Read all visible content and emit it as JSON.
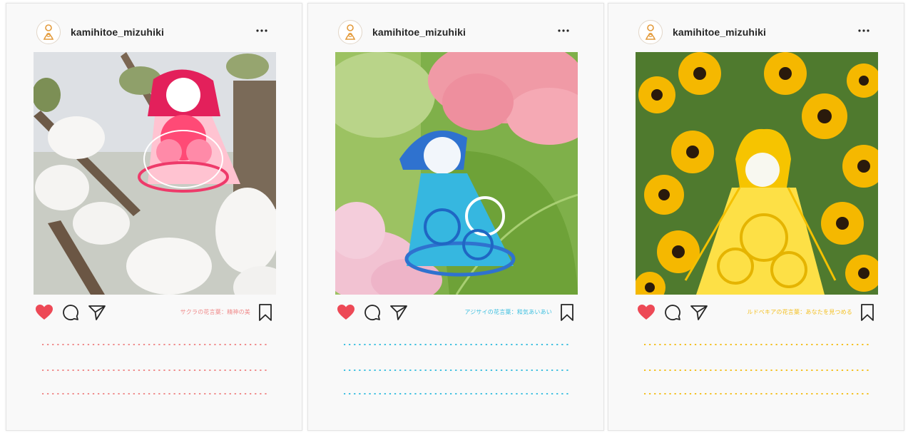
{
  "posts": [
    {
      "username": "kamihitoe_mizuhiki",
      "avatar_icon": "mizuhiki-doll-logo",
      "caption": "サクラの花言葉：精神の美",
      "accent": "#f08a8a",
      "photo_icon": "cherry-blossom-mizuhiki-doll-photo",
      "liked": true
    },
    {
      "username": "kamihitoe_mizuhiki",
      "avatar_icon": "mizuhiki-doll-logo",
      "caption": "アジサイの花言葉：和気あいあい",
      "accent": "#3ec0e0",
      "photo_icon": "hydrangea-mizuhiki-doll-photo",
      "liked": true
    },
    {
      "username": "kamihitoe_mizuhiki",
      "avatar_icon": "mizuhiki-doll-logo",
      "caption": "ルドベキアの花言葉：あなたを見つめる",
      "accent": "#f4c020",
      "photo_icon": "rudbeckia-mizuhiki-doll-photo",
      "liked": true
    }
  ],
  "icons": {
    "more": "more-options-icon",
    "like": "heart-icon",
    "comment": "comment-icon",
    "share": "share-icon",
    "save": "bookmark-icon"
  },
  "colors": {
    "like": "#ed4956",
    "text": "#262626",
    "card_bg": "#f9f9f9"
  }
}
